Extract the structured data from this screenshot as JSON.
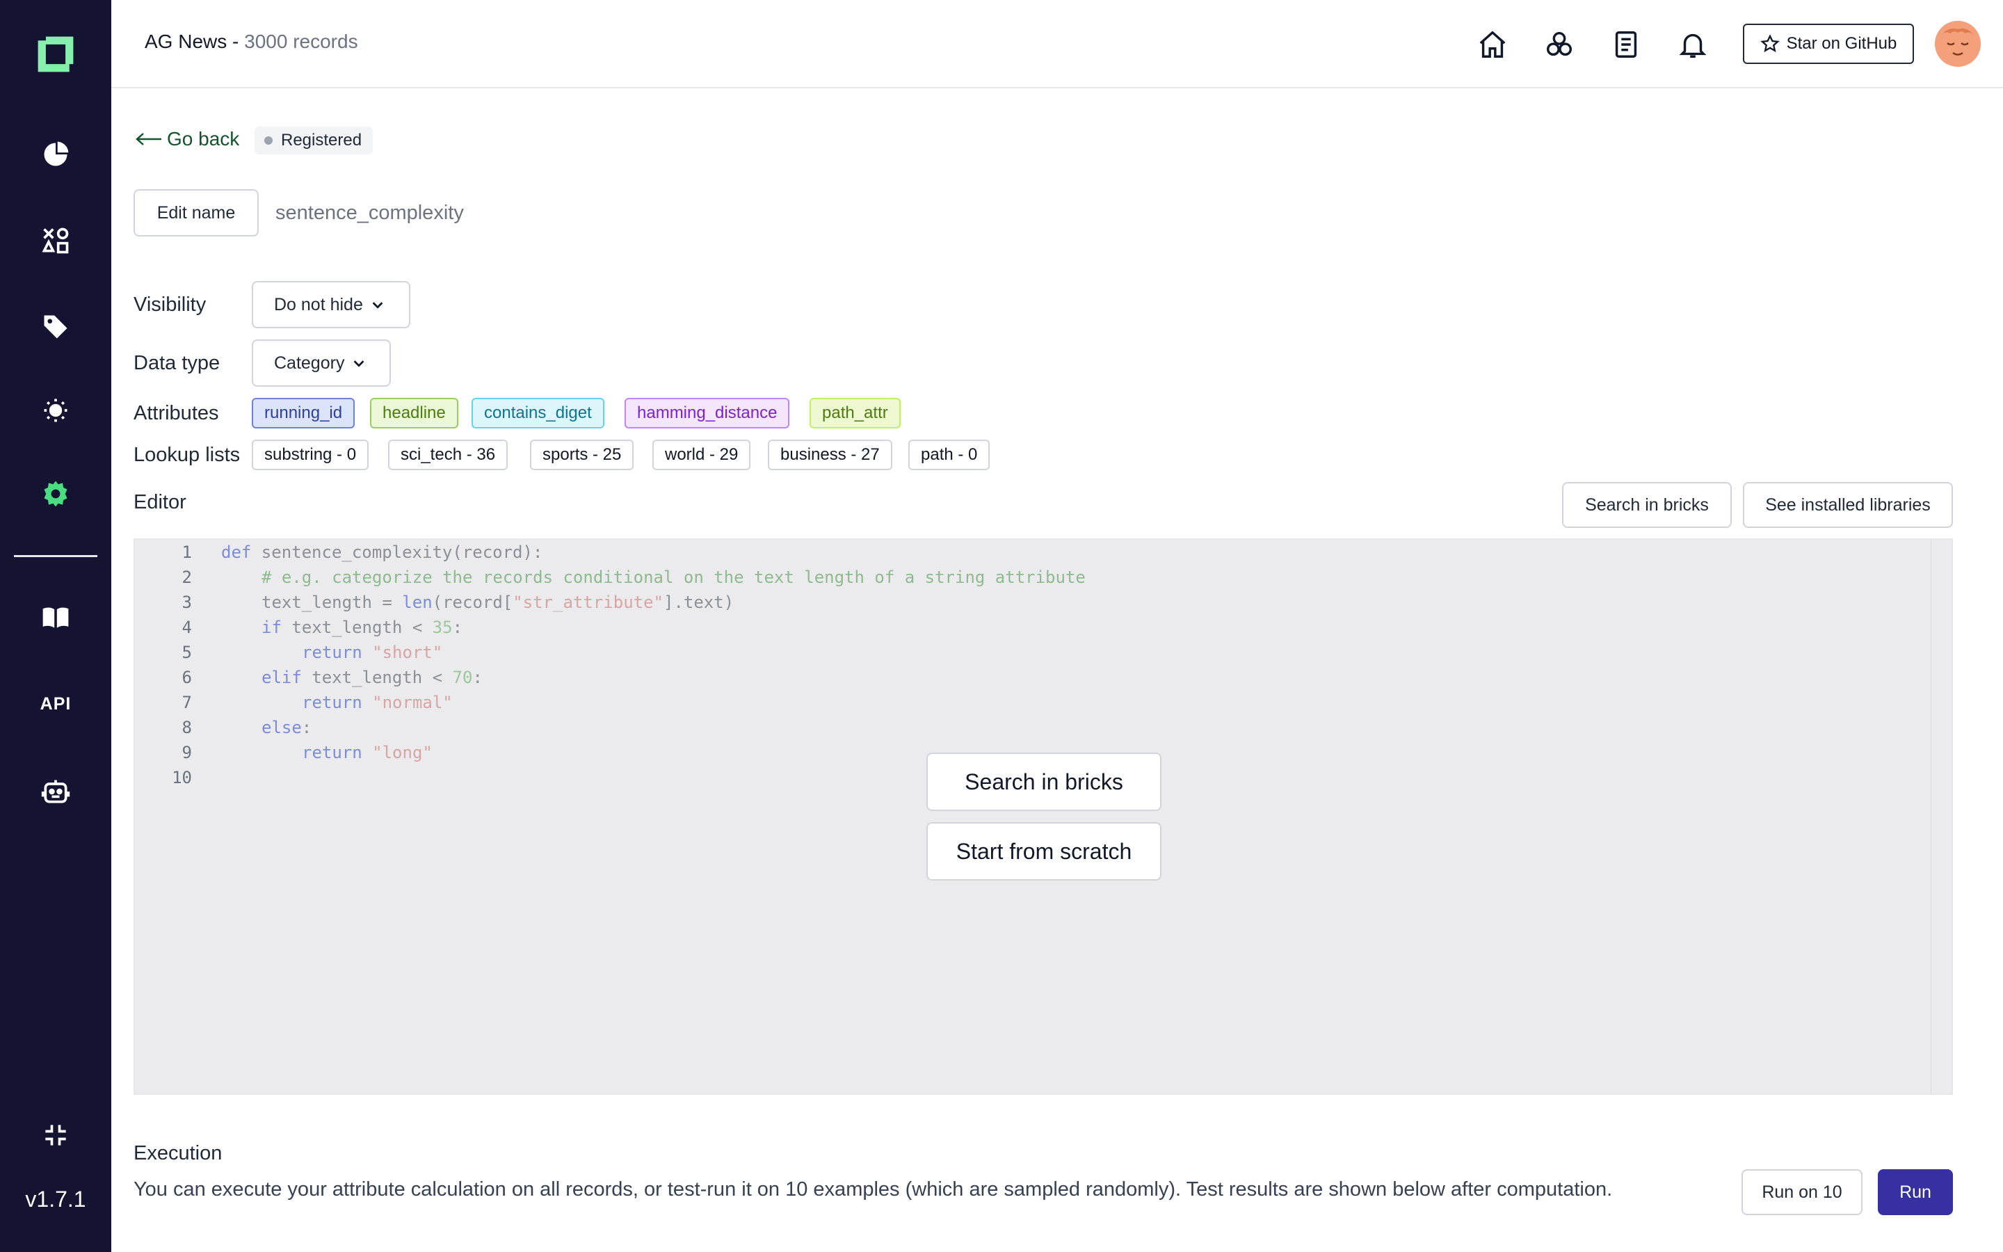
{
  "app": {
    "version": "v1.7.1",
    "sidebar_items": [
      "logo-icon",
      "pie-chart-icon",
      "shapes-icon",
      "tag-icon",
      "lightbulb-icon",
      "gear-icon",
      "book-icon",
      "api-icon",
      "robot-icon",
      "minimize-icon"
    ],
    "api_label": "API",
    "accent_color": "#4ade80",
    "sidebar_color": "#141432"
  },
  "header": {
    "project_name": "AG News - ",
    "record_count": "3000 records",
    "icons": [
      "home-icon",
      "brick-icon",
      "document-icon",
      "bell-icon"
    ],
    "github_label": "Star on GitHub"
  },
  "nav": {
    "go_back": "Go back",
    "status": "Registered"
  },
  "attribute": {
    "edit_name_label": "Edit name",
    "name": "sentence_complexity",
    "visibility_label": "Visibility",
    "visibility_value": "Do not hide",
    "datatype_label": "Data type",
    "datatype_value": "Category",
    "attributes_label": "Attributes",
    "attributes": [
      {
        "name": "running_id",
        "bg": "#dbe4fb",
        "border": "#6b83d8",
        "color": "#2e3f9a"
      },
      {
        "name": "headline",
        "bg": "#ebf8d8",
        "border": "#9ccc65",
        "color": "#4d7c0f"
      },
      {
        "name": "contains_diget",
        "bg": "#dcf6fb",
        "border": "#67d3e6",
        "color": "#0e7490"
      },
      {
        "name": "hamming_distance",
        "bg": "#f3e6fd",
        "border": "#c084fc",
        "color": "#7e22ce"
      },
      {
        "name": "path_attr",
        "bg": "#eef9d2",
        "border": "#bef264",
        "color": "#4d7c0f"
      }
    ],
    "lookup_label": "Lookup lists",
    "lookup_lists": [
      "substring - 0",
      "sci_tech - 36",
      "sports - 25",
      "world - 29",
      "business - 27",
      "path - 0"
    ]
  },
  "editor": {
    "label": "Editor",
    "search_bricks_label": "Search in bricks",
    "installed_libraries_label": "See installed libraries",
    "overlay_search_label": "Search in bricks",
    "overlay_scratch_label": "Start from scratch",
    "line_numbers": [
      "1",
      "2",
      "3",
      "4",
      "5",
      "6",
      "7",
      "8",
      "9",
      "10"
    ],
    "code": {
      "l1_kw": "def",
      "l1_rest": " sentence_complexity(record):",
      "l2": "# e.g. categorize the records conditional on the text length of a string attribute",
      "l3_a": "text_length = ",
      "l3_fn": "len",
      "l3_b": "(record[",
      "l3_str": "\"str_attribute\"",
      "l3_c": "].text)",
      "l4_kw": "if",
      "l4_a": " text_length < ",
      "l4_num": "35",
      "l4_b": ":",
      "l5_kw": "return",
      "l5_str": "\"short\"",
      "l6_kw": "elif",
      "l6_a": " text_length < ",
      "l6_num": "70",
      "l6_b": ":",
      "l7_kw": "return",
      "l7_str": "\"normal\"",
      "l8_kw": "else",
      "l8_b": ":",
      "l9_kw": "return",
      "l9_str": "\"long\""
    }
  },
  "execution": {
    "title": "Execution",
    "description": "You can execute your attribute calculation on all records, or test-run it on 10 examples (which are sampled randomly). Test results are shown below after computation.",
    "run_on_10_label": "Run on 10",
    "run_label": "Run"
  }
}
